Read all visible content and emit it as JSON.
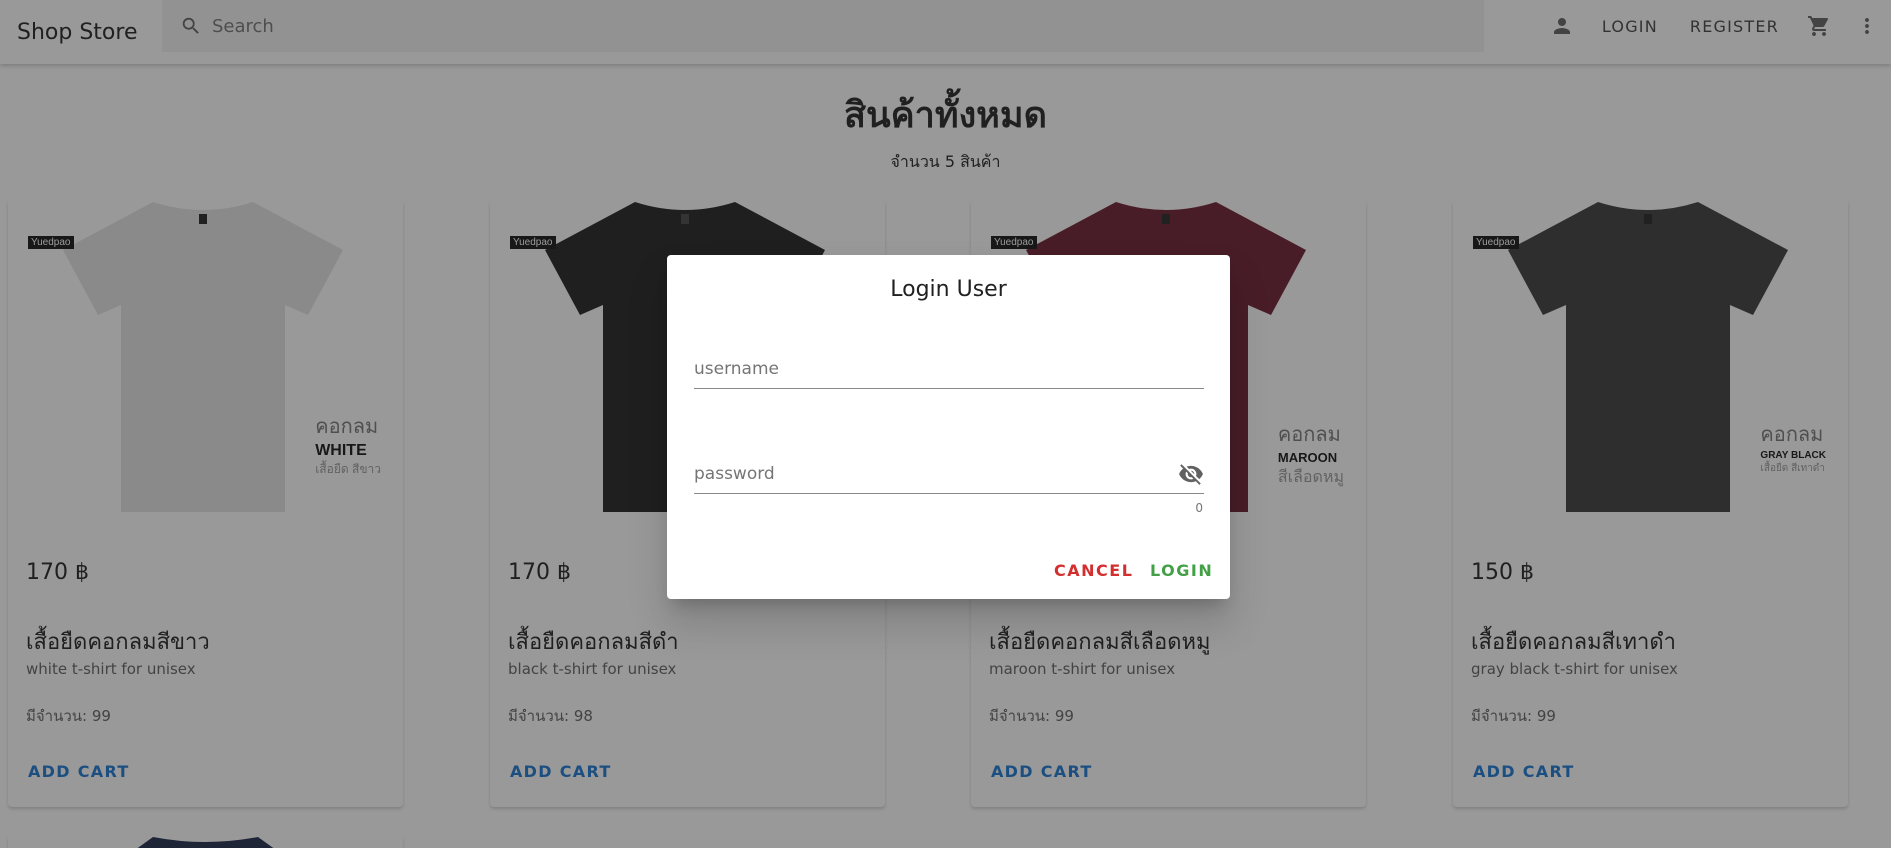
{
  "header": {
    "brand": "Shop Store",
    "search_placeholder": "Search",
    "login_label": "LOGIN",
    "register_label": "REGISTER"
  },
  "main": {
    "title": "สินค้าทั้งหมด",
    "count_text": "จำนวน 5 สินค้า"
  },
  "products": [
    {
      "price": "170 ฿",
      "name": "เสื้อยืดคอกลมสีขาว",
      "description": "white t-shirt for unisex",
      "qty_label": "มีจำนวน: 99",
      "add_label": "ADD CART",
      "brand_tag": "Yuedpao",
      "label_th": "คอกลม",
      "label_en": "WHITE",
      "label_sub": "เสื้อยืด สีขาว",
      "shirt_color": "#e4e4e4"
    },
    {
      "price": "170 ฿",
      "name": "เสื้อยืดคอกลมสีดำ",
      "description": "black t-shirt for unisex",
      "qty_label": "มีจำนวน: 98",
      "add_label": "ADD CART",
      "brand_tag": "Yuedpao",
      "label_th": "",
      "label_en": "",
      "label_sub": "",
      "shirt_color": "#1f1f1f"
    },
    {
      "price": "",
      "name": "เสื้อยืดคอกลมสีเลือดหมู",
      "description": "maroon t-shirt for unisex",
      "qty_label": "มีจำนวน: 99",
      "add_label": "ADD CART",
      "brand_tag": "Yuedpao",
      "label_th": "คอกลม",
      "label_en": "MAROON",
      "label_sub": "สีเลือดหมู",
      "shirt_color": "#6a1a2e"
    },
    {
      "price": "150 ฿",
      "name": "เสื้อยืดคอกลมสีเทาดำ",
      "description": "gray black t-shirt for unisex",
      "qty_label": "มีจำนวน: 99",
      "add_label": "ADD CART",
      "brand_tag": "Yuedpao",
      "label_th": "คอกลม",
      "label_en": "GRAY BLACK",
      "label_sub": "เสื้อยืด สีเทาดำ",
      "shirt_color": "#3a3a3a"
    }
  ],
  "dialog": {
    "title": "Login User",
    "username_placeholder": "username",
    "password_placeholder": "password",
    "char_counter": "0",
    "cancel_label": "CANCEL",
    "login_label": "LOGIN"
  },
  "colors": {
    "accent": "#1976d2",
    "cancel": "#d32f2f",
    "confirm": "#43a047"
  },
  "icons": {
    "search": "search-icon",
    "account": "account-icon",
    "cart": "cart-icon",
    "more": "more-vert-icon",
    "visibility_off": "eye-off-icon"
  }
}
